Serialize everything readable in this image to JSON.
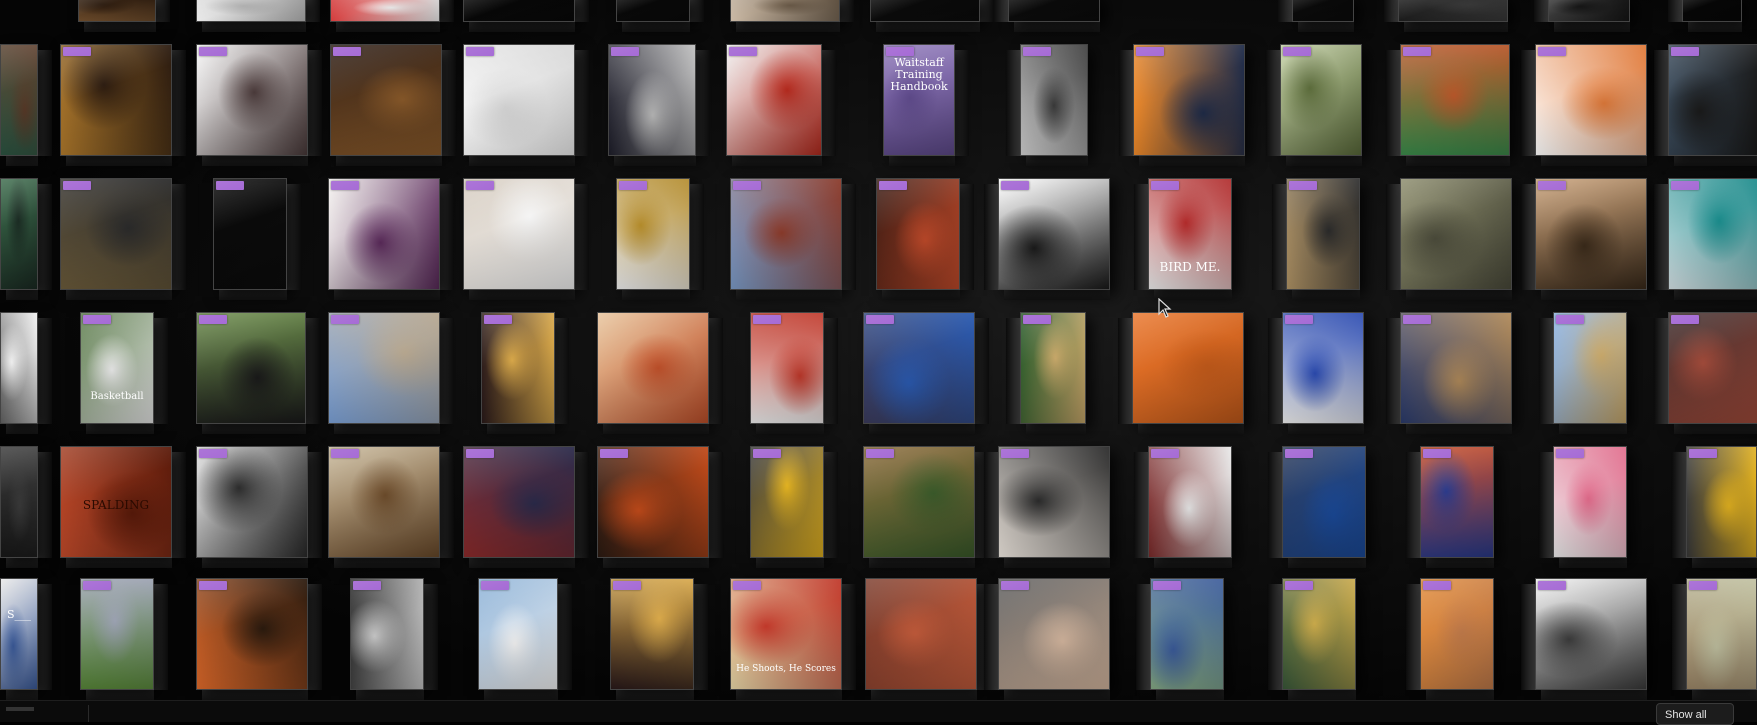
{
  "wall": {
    "tiles": [
      {
        "c": "#6b4a2a",
        "c2": "#2a1a0e",
        "tag": false
      },
      {
        "c": "#e8e8e8",
        "c2": "#b0b0b0",
        "tag": false
      },
      {
        "c": "#d33a3a",
        "c2": "#f2f2f2",
        "tag": false
      },
      {
        "c": "#f4f4f4",
        "c2": "#222",
        "tag": false
      },
      {
        "c": "#f1f1f1",
        "c2": "#333",
        "tag": false
      },
      {
        "c": "#c9b8a4",
        "c2": "#6a5a48",
        "tag": false
      },
      {
        "c": "#2b2b2b",
        "c2": "#111",
        "tag": false
      },
      {
        "c": "#ececec",
        "c2": "#bbb",
        "tag": false
      },
      {
        "c": "#f2f2f2",
        "c2": "#ccc",
        "tag": false
      },
      {
        "c": "#1b1b1b",
        "c2": "#3b3b3b",
        "tag": false
      },
      {
        "c": "#3b3b3b",
        "c2": "#151515",
        "tag": false
      },
      {
        "c": "#eaeaea",
        "c2": "#888",
        "tag": false
      },
      {
        "c": "#2f5a46",
        "c2": "#5a3a28",
        "tag": false
      },
      {
        "c": "#b07a2c",
        "c2": "#2a1a0f",
        "tag": true
      },
      {
        "c": "#f5f5f5",
        "c2": "#4a3a3a",
        "tag": true
      },
      {
        "c": "#2a1a12",
        "c2": "#8a5a2a",
        "tag": true
      },
      {
        "c": "#ffffff",
        "c2": "#d8d8d8",
        "tag": true
      },
      {
        "c": "#1e1e2a",
        "c2": "#bfbfbf",
        "tag": true
      },
      {
        "c": "#f0f0f0",
        "c2": "#b52a1e",
        "tag": true
      },
      {
        "c": "#8e78b8",
        "c2": "#5e4a8a",
        "tag": true
      },
      {
        "c": "#d9d9d9",
        "c2": "#3b3b3b",
        "tag": true
      },
      {
        "c": "#ef8a2a",
        "c2": "#1f2c4a",
        "tag": true
      },
      {
        "c": "#c4d0a6",
        "c2": "#5a6a3a",
        "tag": true
      },
      {
        "c": "#3a8a4a",
        "c2": "#b8572a",
        "tag": true
      },
      {
        "c": "#ffffff",
        "c2": "#e07a3a",
        "tag": true
      },
      {
        "c": "#3a4a5a",
        "c2": "#1a1a1a",
        "tag": true
      },
      {
        "c": "#3a6a4a",
        "c2": "#1a2a22",
        "tag": false
      },
      {
        "c": "#6a5a3a",
        "c2": "#2a2a2a",
        "tag": true
      },
      {
        "c": "#ffffff",
        "c2": "#222",
        "tag": true
      },
      {
        "c": "#f3f0ee",
        "c2": "#5a2a5a",
        "tag": true
      },
      {
        "c": "#d6ccc0",
        "c2": "#f5f5f5",
        "tag": true
      },
      {
        "c": "#f6f6f6",
        "c2": "#b28a2a",
        "tag": true
      },
      {
        "c": "#7a9ac6",
        "c2": "#8a3a2a",
        "tag": true
      },
      {
        "c": "#3a1a12",
        "c2": "#c04a2a",
        "tag": true
      },
      {
        "c": "#ffffff",
        "c2": "#1a1a1a",
        "tag": true
      },
      {
        "c": "#f2f2f2",
        "c2": "#b02a2a",
        "tag": true
      },
      {
        "c": "#b89a6a",
        "c2": "#2a2a2a",
        "tag": true
      },
      {
        "c": "#8a8a6a",
        "c2": "#4a4a3a",
        "tag": false
      },
      {
        "c": "#c8a078",
        "c2": "#3a2a1a",
        "tag": true
      },
      {
        "c": "#d9e6ea",
        "c2": "#1a8a8a",
        "tag": true
      },
      {
        "c": "#6a6a6a",
        "c2": "#f0f0f0",
        "tag": false
      },
      {
        "c": "#5a7a4a",
        "c2": "#e8e8e8",
        "tag": true
      },
      {
        "c": "#6a8a4a",
        "c2": "#1a1a1a",
        "tag": true
      },
      {
        "c": "#7aa0d6",
        "c2": "#b8a890",
        "tag": true
      },
      {
        "c": "#2a1a1a",
        "c2": "#d8a84a",
        "tag": true
      },
      {
        "c": "#e7c39a",
        "c2": "#c0502a",
        "tag": false
      },
      {
        "c": "#f2f2f2",
        "c2": "#c0382a",
        "tag": true
      },
      {
        "c": "#3a3a5a",
        "c2": "#2a5ab0",
        "tag": true
      },
      {
        "c": "#2a5a2a",
        "c2": "#c8a86a",
        "tag": true
      },
      {
        "c": "#e8742a",
        "c2": "#c25a1a",
        "tag": false
      },
      {
        "c": "#f5f5f5",
        "c2": "#2a4ab0",
        "tag": true
      },
      {
        "c": "#2a3a6a",
        "c2": "#b08a5a",
        "tag": true
      },
      {
        "c": "#8ab0e0",
        "c2": "#c8a86a",
        "tag": true
      },
      {
        "c": "#3a2a2a",
        "c2": "#a04a3a",
        "tag": true
      },
      {
        "c": "#1a1a1a",
        "c2": "#3a3a3a",
        "tag": false
      },
      {
        "c": "#c04a2a",
        "c2": "#5a1a0a",
        "tag": false
      },
      {
        "c": "#dcdcdc",
        "c2": "#2a2a2a",
        "tag": true
      },
      {
        "c": "#c8b89a",
        "c2": "#6a4a2a",
        "tag": true
      },
      {
        "c": "#8a2a2a",
        "c2": "#2a2a4a",
        "tag": true
      },
      {
        "c": "#2a1a12",
        "c2": "#c04a1a",
        "tag": true
      },
      {
        "c": "#3a3a3a",
        "c2": "#e0b020",
        "tag": true
      },
      {
        "c": "#8a6a3a",
        "c2": "#3a5a2a",
        "tag": true
      },
      {
        "c": "#efe8e0",
        "c2": "#2a2a2a",
        "tag": true
      },
      {
        "c": "#7a2a2a",
        "c2": "#e8e8e8",
        "tag": true
      },
      {
        "c": "#2a3a5a",
        "c2": "#1a4a9a",
        "tag": true
      },
      {
        "c": "#c04a2a",
        "c2": "#2a3a8a",
        "tag": true
      },
      {
        "c": "#f2f2f2",
        "c2": "#e06a8a",
        "tag": true
      },
      {
        "c": "#3a3a3a",
        "c2": "#e0b020",
        "tag": true
      },
      {
        "c": "#e8e8e8",
        "c2": "#3a5a9a",
        "tag": false
      },
      {
        "c": "#5a8a3a",
        "c2": "#9aa0b0",
        "tag": true
      },
      {
        "c": "#e06a2a",
        "c2": "#2a1a0e",
        "tag": true
      },
      {
        "c": "#2a2a2a",
        "c2": "#c8c8c8",
        "tag": true
      },
      {
        "c": "#8ab0d6",
        "c2": "#f5f5f5",
        "tag": true
      },
      {
        "c": "#2a1a1a",
        "c2": "#d8a84a",
        "tag": true
      },
      {
        "c": "#e8d8a8",
        "c2": "#c0382a",
        "tag": true
      },
      {
        "c": "#7a3a2a",
        "c2": "#c05a3a",
        "tag": false
      },
      {
        "c": "#5a5a5a",
        "c2": "#d6b8a0",
        "tag": true
      },
      {
        "c": "#8ab08a",
        "c2": "#3a5a9a",
        "tag": true
      },
      {
        "c": "#3a5a3a",
        "c2": "#c8a84a",
        "tag": true
      },
      {
        "c": "#e08a3a",
        "c2": "#c07a4a",
        "tag": true
      },
      {
        "c": "#f2f2f2",
        "c2": "#3a3a3a",
        "tag": true
      },
      {
        "c": "#a08a6a",
        "c2": "#c0c0a0",
        "tag": true
      }
    ],
    "captions": {
      "handbook": "Waitstaff\nTraining\nHandbook",
      "bird": "BIRD ME.",
      "shoots": "He Shoots, He Scores",
      "ball": "SPALDING",
      "stamp": "S___",
      "banner": "Basketball"
    }
  },
  "bottom_bar": {
    "show_all_label": "Show all"
  }
}
